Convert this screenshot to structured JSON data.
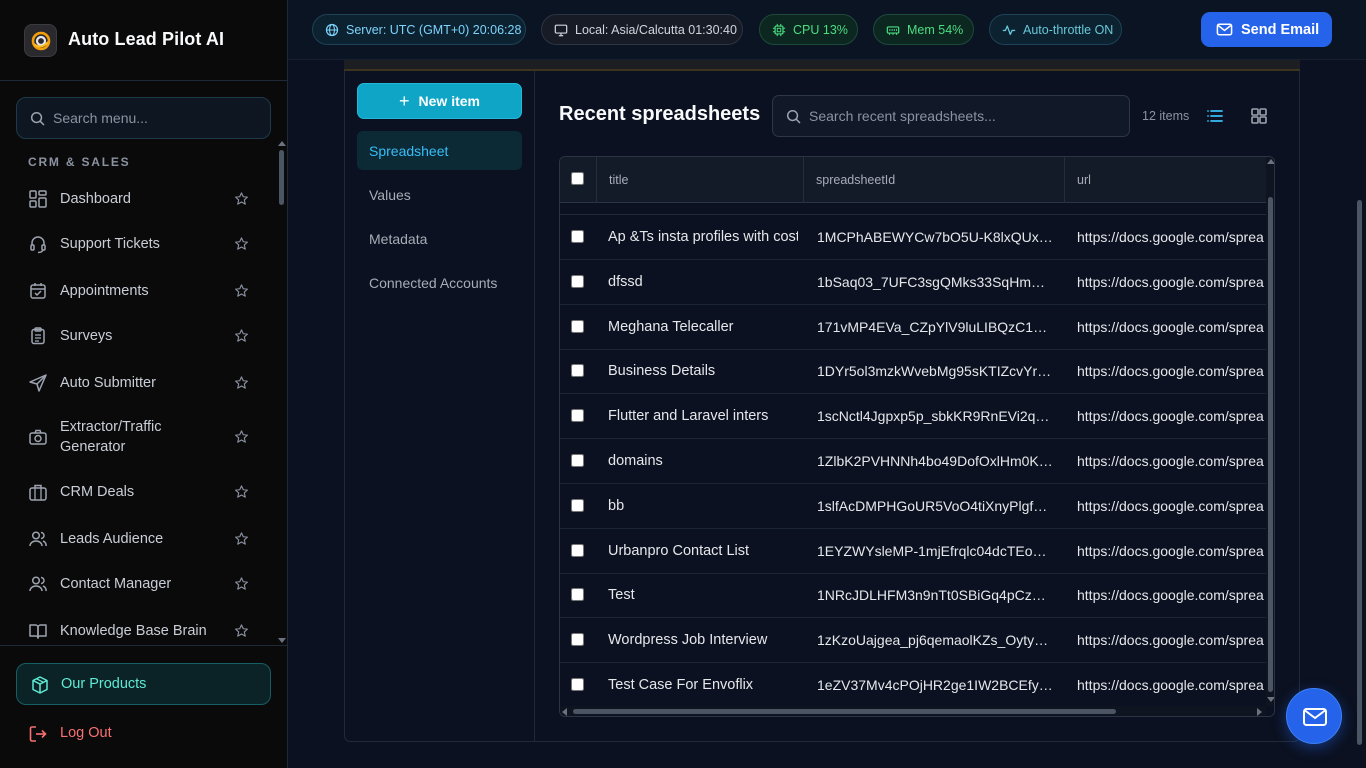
{
  "app": {
    "title": "Auto Lead Pilot AI"
  },
  "sidebar": {
    "search_placeholder": "Search menu...",
    "section": "CRM & SALES",
    "items": [
      {
        "label": "Dashboard",
        "icon": "dashboard-icon"
      },
      {
        "label": "Support Tickets",
        "icon": "headset-icon"
      },
      {
        "label": "Appointments",
        "icon": "calendar-icon"
      },
      {
        "label": "Surveys",
        "icon": "clipboard-icon"
      },
      {
        "label": "Auto Submitter",
        "icon": "send-icon"
      },
      {
        "label": "Extractor/Traffic Generator",
        "icon": "camera-icon"
      },
      {
        "label": "CRM Deals",
        "icon": "briefcase-icon"
      },
      {
        "label": "Leads Audience",
        "icon": "users-icon"
      },
      {
        "label": "Contact Manager",
        "icon": "users-icon"
      },
      {
        "label": "Knowledge Base Brain",
        "icon": "book-icon"
      }
    ],
    "products_label": "Our Products",
    "logout_label": "Log Out"
  },
  "topbar": {
    "server": "Server: UTC (GMT+0) 20:06:28",
    "local": "Local: Asia/Calcutta 01:30:40",
    "cpu": "CPU 13%",
    "mem": "Mem 54%",
    "throttle": "Auto-throttle ON",
    "send_email": "Send Email"
  },
  "panel": {
    "new_item": "New item",
    "tabs": [
      "Spreadsheet",
      "Values",
      "Metadata",
      "Connected Accounts"
    ],
    "active_tab": "Spreadsheet"
  },
  "spreadsheets": {
    "title": "Recent spreadsheets",
    "search_placeholder": "Search recent spreadsheets...",
    "count": "12 items",
    "columns": [
      "title",
      "spreadsheetId",
      "url"
    ],
    "rows": [
      {
        "title": "Ap &Ts insta profiles with cost",
        "id": "1MCPhABEWYCw7bO5U-K8lxQUx…",
        "url": "https://docs.google.com/sprea"
      },
      {
        "title": "dfssd",
        "id": "1bSaq03_7UFC3sgQMks33SqHm…",
        "url": "https://docs.google.com/sprea"
      },
      {
        "title": "Meghana Telecaller",
        "id": "171vMP4EVa_CZpYlV9luLIBQzC1…",
        "url": "https://docs.google.com/sprea"
      },
      {
        "title": "Business Details",
        "id": "1DYr5ol3mzkWvebMg95sKTIZcvYr…",
        "url": "https://docs.google.com/sprea"
      },
      {
        "title": "Flutter and Laravel inters",
        "id": "1scNctl4Jgpxp5p_sbkKR9RnEVi2q…",
        "url": "https://docs.google.com/sprea"
      },
      {
        "title": "domains",
        "id": "1ZlbK2PVHNNh4bo49DofOxlHm0K…",
        "url": "https://docs.google.com/sprea"
      },
      {
        "title": "bb",
        "id": "1slfAcDMPHGoUR5VoO4tiXnyPlgf…",
        "url": "https://docs.google.com/sprea"
      },
      {
        "title": "Urbanpro Contact List",
        "id": "1EYZWYsleMP-1mjEfrqlc04dcTEo…",
        "url": "https://docs.google.com/sprea"
      },
      {
        "title": "Test",
        "id": "1NRcJDLHFM3n9nTt0SBiGq4pCz…",
        "url": "https://docs.google.com/sprea"
      },
      {
        "title": "Wordpress Job Interview",
        "id": "1zKzoUajgea_pj6qemaolKZs_Oyty…",
        "url": "https://docs.google.com/sprea"
      },
      {
        "title": "Test Case For Envoflix",
        "id": "1eZV37Mv4cPOjHR2ge1IW2BCEfy…",
        "url": "https://docs.google.com/sprea"
      }
    ]
  },
  "colors": {
    "accent": "#0ea5c6",
    "primary": "#2563eb",
    "danger": "#f87171",
    "success": "#4ade80"
  }
}
